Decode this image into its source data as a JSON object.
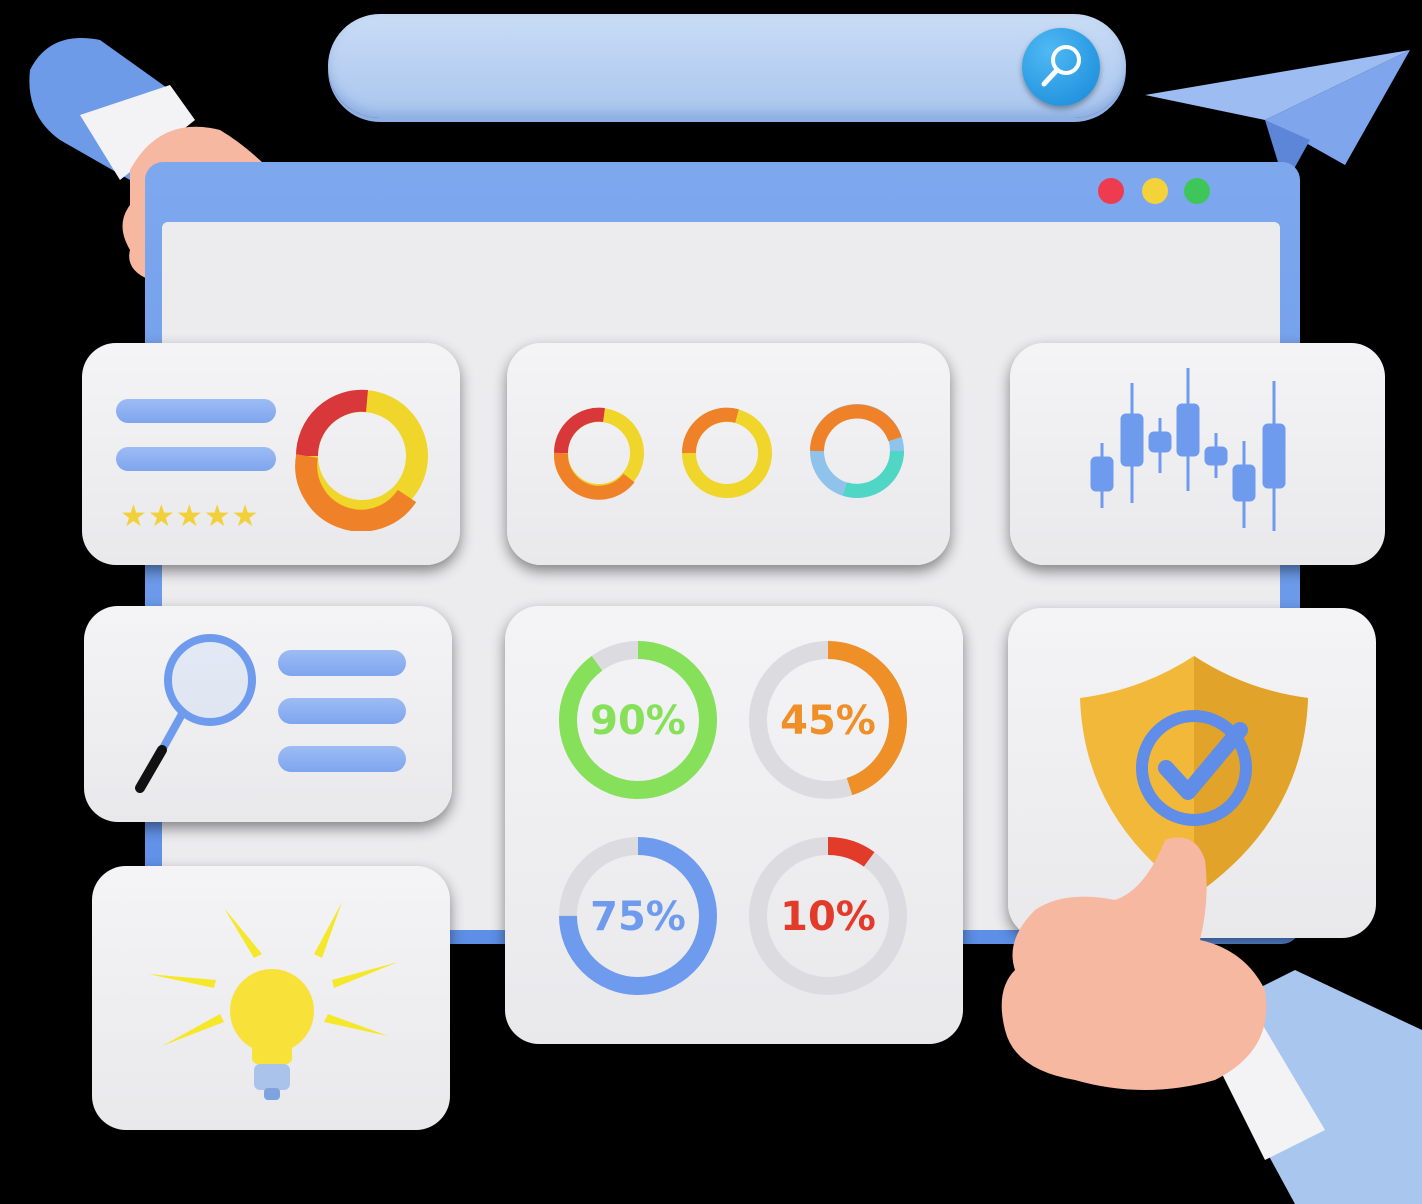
{
  "colors": {
    "accent_blue": "#6f9bef",
    "green": "#86e05a",
    "orange": "#ef8f28",
    "red": "#e33b2a",
    "yellow": "#f3d52a",
    "teal": "#4fd6c4",
    "shield_gold": "#f2b83a"
  },
  "search": {
    "icon": "search-icon"
  },
  "window": {
    "controls": [
      "close",
      "minimize",
      "maximize"
    ]
  },
  "rating": {
    "stars": 5
  },
  "progress": [
    {
      "label": "90%",
      "value": 90,
      "color": "#86e05a"
    },
    {
      "label": "45%",
      "value": 45,
      "color": "#ef8f28"
    },
    {
      "label": "75%",
      "value": 75,
      "color": "#6f9bef"
    },
    {
      "label": "10%",
      "value": 10,
      "color": "#e33b2a"
    }
  ],
  "icons": [
    "hand-pointing-icon",
    "paper-plane-icon",
    "magnifier-icon",
    "lightbulb-icon",
    "shield-check-icon",
    "thumbs-up-hand-icon",
    "candlestick-chart-icon"
  ]
}
